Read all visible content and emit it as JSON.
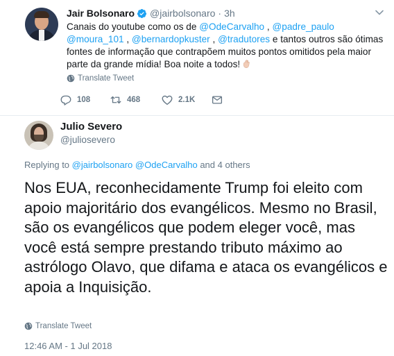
{
  "parent_tweet": {
    "author_name": "Jair Bolsonaro",
    "author_handle": "@jairbolsonaro",
    "separator": "·",
    "time": "3h",
    "text": {
      "p1": "Canais do youtube como os de ",
      "m1": "@OdeCarvalho",
      "p2": " , ",
      "m2": "@padre_paulo",
      "p3": " ",
      "m3": "@moura_101",
      "p4": " , ",
      "m4": "@bernardopkuster",
      "p5": " , ",
      "m5": "@tradutores",
      "p6": " e tantos outros são ótimas fontes de informação que contrapõem muitos pontos omitidos pela maior parte da grande mídia! Boa noite a todos!"
    },
    "translate_label": "Translate Tweet",
    "reply_count": "108",
    "retweet_count": "468",
    "like_count": "2.1K"
  },
  "main_tweet": {
    "author_name": "Julio Severo",
    "author_handle": "@julioseveго",
    "replying_prefix": "Replying to ",
    "replying_m1": "@jairbolsonaro",
    "replying_sep": " ",
    "replying_m2": "@OdeCarvalho",
    "replying_suffix": " and 4 others",
    "text": "Nos EUA, reconhecidamente Trump foi eleito com apoio majoritário dos evangélicos. Mesmo no Brasil, são os evangélicos que podem eleger você, mas você está sempre prestando tributo máximo ao astrólogo Olavo, que difama e ataca os evangélicos e apoia a Inquisição.",
    "translate_label": "Translate Tweet",
    "timestamp": "12:46 AM - 1 Jul 2018"
  },
  "colors": {
    "link": "#1da1f2",
    "secondary_text": "#657786",
    "primary_text": "#14171a",
    "divider": "#e6ecf0"
  },
  "icons": {
    "verified": "verified-badge-icon",
    "chevron": "chevron-down-icon",
    "globe": "globe-icon",
    "reply": "reply-icon",
    "retweet": "retweet-icon",
    "like": "heart-icon",
    "dm": "envelope-icon",
    "emoji": "waving-hand-emoji"
  }
}
